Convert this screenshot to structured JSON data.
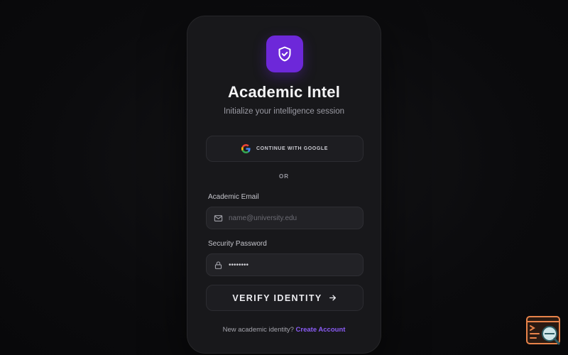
{
  "app": {
    "title": "Academic Intel",
    "subtitle": "Initialize your intelligence session"
  },
  "icons": {
    "logo": "shield-check-icon",
    "google": "google-icon",
    "email": "mail-icon",
    "password": "lock-icon",
    "submit": "arrow-right-icon",
    "widget": "terminal-search-icon"
  },
  "auth": {
    "google_label": "CONTINUE WITH GOOGLE",
    "divider": "OR",
    "email_label": "Academic Email",
    "email_placeholder": "name@university.edu",
    "password_label": "Security Password",
    "password_value": "••••••••",
    "submit_label": "VERIFY IDENTITY"
  },
  "footer": {
    "prompt": "New academic identity?",
    "link": "Create Account"
  },
  "colors": {
    "accent": "#6d28d9",
    "link": "#8b5cf6",
    "card": "#18181b",
    "background": "#0b0b0d",
    "widget": "#e8834a"
  }
}
